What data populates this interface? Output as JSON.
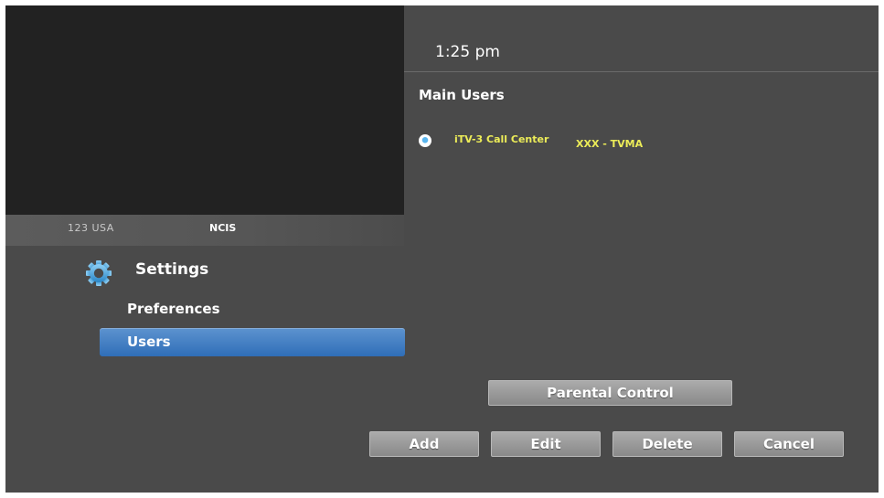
{
  "player": {
    "channel_number": "123 USA",
    "program_name": "NCIS"
  },
  "header": {
    "clock": "1:25 pm"
  },
  "users_panel": {
    "heading": "Main Users",
    "users": [
      {
        "name": "iTV-3 Call Center",
        "rating": "XXX - TVMA",
        "selected": true
      }
    ]
  },
  "settings_menu": {
    "title": "Settings",
    "icon": "gear-icon",
    "items": [
      {
        "label": "Preferences",
        "selected": false
      },
      {
        "label": "Users",
        "selected": true
      }
    ]
  },
  "buttons": {
    "parental_control": "Parental Control",
    "add": "Add",
    "edit": "Edit",
    "delete": "Delete",
    "cancel": "Cancel"
  },
  "colors": {
    "background": "#4a4a4a",
    "video": "#222222",
    "accent_selected": "#3b78c0",
    "user_text": "#ecec58",
    "radio": "#5ab6ef"
  }
}
